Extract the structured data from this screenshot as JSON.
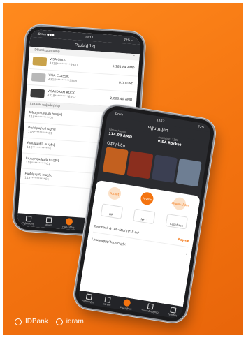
{
  "phone1": {
    "status_left": "IDram ●●●",
    "status_center": "13:12",
    "status_right": "72% ▭",
    "title": "Բանկինգ",
    "cards_section": "IDBank քարտեր",
    "cards": [
      {
        "name": "VISA GOLD",
        "number": "4318*********9981",
        "amount": "5,181.84 AMD",
        "color": "#c9a24a"
      },
      {
        "name": "VISA CLASSIC",
        "number": "4318*********5508",
        "amount": "0.00 USD",
        "color": "#b8b8b8"
      },
      {
        "name": "VISA IDRAM ROCK...",
        "number": "4318*********6352",
        "amount": "2,000.40 AMD",
        "color": "#3a3a3a"
      }
    ],
    "deposits_section": "IDBank ավանդներ",
    "deposits": [
      {
        "name": "Խնայողական հաշիվ",
        "number": "118**********01",
        "amount": "2,070.02 USD"
      },
      {
        "name": "Բանկային հաշիվ",
        "number": "118**********01",
        "amount": "0.00 AMD"
      },
      {
        "name": "Բանկային հաշիվ",
        "number": "118**********01",
        "amount": "0.00 EUR"
      },
      {
        "name": "Խնայողական հաշիվ",
        "number": "118**********01",
        "amount": "1,000,000.20 AMD"
      },
      {
        "name": "Բանկային հաշիվ",
        "number": "118**********01",
        "amount": "0.00 USD"
      }
    ],
    "tabs": [
      "Գլխավոր",
      "Idram",
      "Բանկինգ",
      "Պատմություն",
      "Պրոֆիլ"
    ]
  },
  "phone2": {
    "status_left": "IDram",
    "status_center": "13:12",
    "status_right": "72%",
    "title": "Գլխավոր",
    "balance1_label": "Idram հաշիվ",
    "balance1_value": "114.08 AMD",
    "balance2_label": "Available: 1300",
    "balance2_value": "VISA Rocket",
    "offers_title": "Օֆերներ",
    "offer_colors": [
      "#c2601f",
      "#8a2e1e",
      "#3b3f52",
      "#6e7e93"
    ],
    "circles": [
      "Rocket",
      "Payme",
      "Վճարումներ"
    ],
    "buttons": [
      "QR",
      "NFC",
      "Cashback"
    ],
    "promo_label": "Cashback & QR ՎՃԱՐՈՒՄՆԵՐ",
    "promo_tag": "Payme",
    "list_label": "Լրացուցիչ/Հաշվեկշիռ",
    "tabs": [
      "Գլխավոր",
      "Idram",
      "Բանկինգ",
      "Պատմություն",
      "Պրոֆիլ"
    ]
  },
  "brand": {
    "bank": "IDBank",
    "wallet": "idram"
  }
}
